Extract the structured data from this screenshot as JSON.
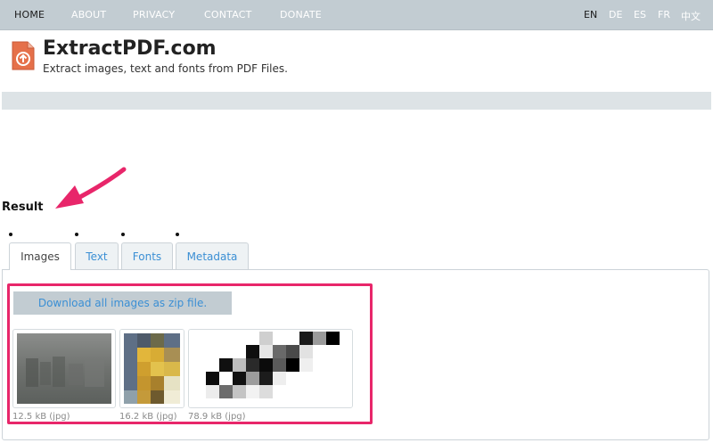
{
  "nav": {
    "items": [
      {
        "label": "HOME",
        "active": true
      },
      {
        "label": "ABOUT",
        "active": false
      },
      {
        "label": "PRIVACY",
        "active": false
      },
      {
        "label": "CONTACT",
        "active": false
      },
      {
        "label": "DONATE",
        "active": false
      }
    ],
    "languages": [
      {
        "label": "EN",
        "active": true
      },
      {
        "label": "DE",
        "active": false
      },
      {
        "label": "ES",
        "active": false
      },
      {
        "label": "FR",
        "active": false
      },
      {
        "label": "中文",
        "active": false
      }
    ]
  },
  "site": {
    "title": "ExtractPDF.com",
    "tagline": "Extract images, text and fonts from PDF Files."
  },
  "result": {
    "heading": "Result",
    "tabs": [
      {
        "label": "Images",
        "active": true
      },
      {
        "label": "Text",
        "active": false
      },
      {
        "label": "Fonts",
        "active": false
      },
      {
        "label": "Metadata",
        "active": false
      }
    ],
    "download_label": "Download all images as zip file.",
    "images": [
      {
        "caption": "12.5 kB (jpg)"
      },
      {
        "caption": "16.2 kB (jpg)"
      },
      {
        "caption": "78.9 kB (jpg)"
      }
    ]
  },
  "colors": {
    "nav_bg": "#c2ccd2",
    "link_blue": "#3b8fd4",
    "highlight_pink": "#e8266a",
    "logo_orange": "#e5704a"
  },
  "icons": {
    "logo": "pdf-file-icon",
    "annotation": "pointer-arrow-icon"
  }
}
